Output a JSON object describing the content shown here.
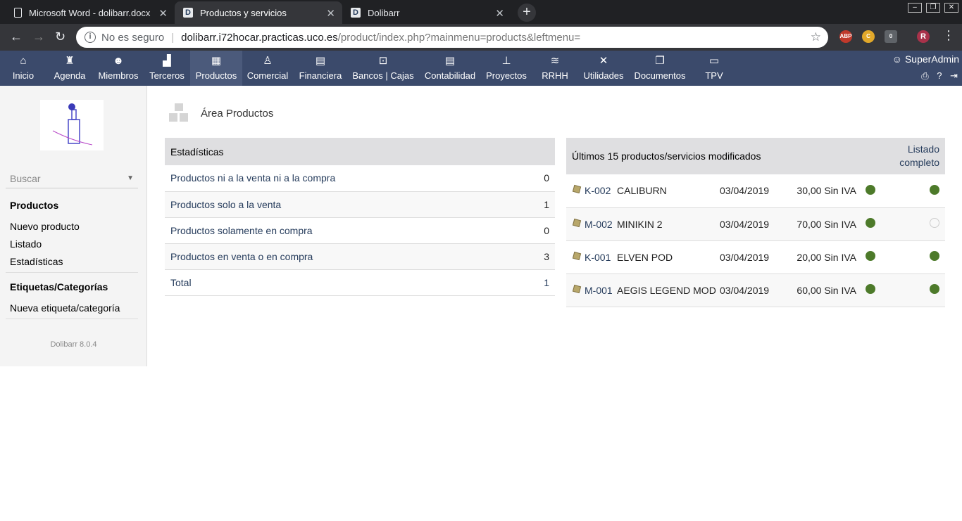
{
  "browser": {
    "tabs": [
      {
        "title": "Microsoft Word - dolibarr.docx",
        "icon": "word-doc-icon"
      },
      {
        "title": "Productos y servicios",
        "icon": "dolibarr-icon"
      },
      {
        "title": "Dolibarr",
        "icon": "dolibarr-icon"
      }
    ],
    "url": {
      "security": "No es seguro",
      "host": "dolibarr.i72hocar.practicas.uco.es",
      "path": "/product/index.php?mainmenu=products&leftmenu="
    },
    "extensions": [
      "ABP",
      "C",
      "0"
    ],
    "profile_initial": "R"
  },
  "topmenu": {
    "items": [
      {
        "label": "Inicio",
        "icon": "home-icon"
      },
      {
        "label": "Agenda",
        "icon": "agenda-icon"
      },
      {
        "label": "Miembros",
        "icon": "members-icon"
      },
      {
        "label": "Terceros",
        "icon": "company-icon"
      },
      {
        "label": "Productos",
        "icon": "products-icon",
        "active": true
      },
      {
        "label": "Comercial",
        "icon": "commercial-icon"
      },
      {
        "label": "Financiera",
        "icon": "billing-icon"
      },
      {
        "label": "Bancos | Cajas",
        "icon": "bank-icon"
      },
      {
        "label": "Contabilidad",
        "icon": "accounting-icon"
      },
      {
        "label": "Proyectos",
        "icon": "projects-icon"
      },
      {
        "label": "RRHH",
        "icon": "hrm-icon"
      },
      {
        "label": "Utilidades",
        "icon": "tools-icon"
      },
      {
        "label": "Documentos",
        "icon": "documents-icon"
      },
      {
        "label": "TPV",
        "icon": "pos-icon"
      }
    ],
    "user": "SuperAdmin"
  },
  "sidebar": {
    "search_placeholder": "Buscar",
    "sections": [
      {
        "title": "Productos",
        "items": [
          "Nuevo producto",
          "Listado",
          "Estadísticas"
        ]
      },
      {
        "title": "Etiquetas/Categorías",
        "items": [
          "Nueva etiqueta/categoría"
        ]
      }
    ],
    "version": "Dolibarr 8.0.4"
  },
  "main": {
    "title": "Área Productos",
    "stats": {
      "header": "Estadísticas",
      "rows": [
        {
          "label": "Productos ni a la venta ni a la compra",
          "value": "0"
        },
        {
          "label": "Productos solo a la venta",
          "value": "1"
        },
        {
          "label": "Productos solamente en compra",
          "value": "0"
        },
        {
          "label": "Productos en venta o en compra",
          "value": "3"
        },
        {
          "label": "Total",
          "value": "1"
        }
      ]
    },
    "latest": {
      "header": "Últimos 15 productos/servicios modificados",
      "link": "Listado completo",
      "rows": [
        {
          "ref": "K-002",
          "label": "CALIBURN",
          "date": "03/04/2019",
          "price": "30,00 Sin IVA",
          "on_sale": true,
          "on_buy": true
        },
        {
          "ref": "M-002",
          "label": "MINIKIN 2",
          "date": "03/04/2019",
          "price": "70,00 Sin IVA",
          "on_sale": true,
          "on_buy": false
        },
        {
          "ref": "K-001",
          "label": "ELVEN POD",
          "date": "03/04/2019",
          "price": "20,00 Sin IVA",
          "on_sale": true,
          "on_buy": true
        },
        {
          "ref": "M-001",
          "label": "AEGIS LEGEND MOD",
          "date": "03/04/2019",
          "price": "60,00 Sin IVA",
          "on_sale": true,
          "on_buy": true
        }
      ]
    }
  },
  "colors": {
    "menu_bg": "#3b4a6b",
    "status_on": "#4d7a2a",
    "link": "#263c5c"
  }
}
